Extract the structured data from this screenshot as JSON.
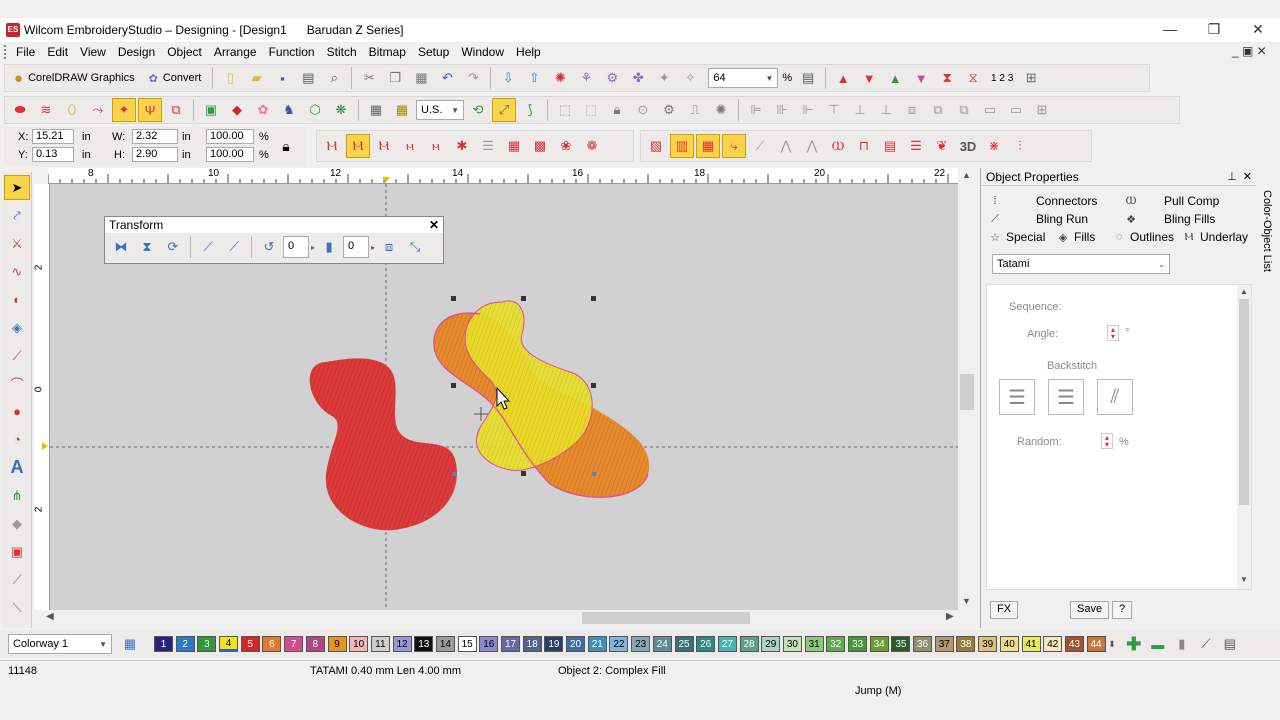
{
  "window": {
    "title": "Wilcom EmbroideryStudio – Designing - [Design1",
    "machine": "Barudan Z Series]",
    "minimize": "—",
    "restore": "❐",
    "close": "✕",
    "mdi_controls": "_ ▣ ✕"
  },
  "menu": [
    "File",
    "Edit",
    "View",
    "Design",
    "Object",
    "Arrange",
    "Function",
    "Stitch",
    "Bitmap",
    "Setup",
    "Window",
    "Help"
  ],
  "toolbar": {
    "coreldraw_label": "CorelDRAW Graphics",
    "convert_label": "Convert",
    "zoom_value": "64",
    "zoom_unit": "%",
    "units_value": "U.S.",
    "sequence_label": "1 2 3"
  },
  "coords": {
    "x_label": "X:",
    "x_value": "15.21",
    "x_unit": "in",
    "y_label": "Y:",
    "y_value": "0.13",
    "y_unit": "in",
    "w_label": "W:",
    "w_value": "2.32",
    "w_unit": "in",
    "h_label": "H:",
    "h_value": "2.90",
    "h_unit": "in",
    "sx_value": "100.00",
    "sx_unit": "%",
    "sy_value": "100.00",
    "sy_unit": "%"
  },
  "stitch_tb": {
    "three_d_label": "3D"
  },
  "ruler": {
    "h_labels": [
      "8",
      "10",
      "12",
      "14",
      "16",
      "18",
      "20",
      "22"
    ],
    "v_labels": [
      "2",
      "0",
      "2"
    ]
  },
  "transform": {
    "title": "Transform",
    "close": "✕",
    "rotate_value": "0",
    "slant_value": "0"
  },
  "object_properties": {
    "title": "Object Properties",
    "pin": "⊥",
    "close": "✕",
    "tabs_row1": [
      "Connectors",
      "Pull Comp"
    ],
    "tabs_row2": [
      "Bling Run",
      "Bling Fills"
    ],
    "tabs_row3": [
      "Special",
      "Fills",
      "Outlines",
      "Underlay"
    ],
    "fill_type": "Tatami",
    "sequence_label": "Sequence:",
    "angle_label": "Angle:",
    "angle_unit": "°",
    "backstitch_label": "Backstitch",
    "random_label": "Random:",
    "random_unit": "%",
    "fx_label": "FX",
    "save_label": "Save",
    "help_label": "?"
  },
  "side_tab_label": "Color-Object List",
  "colorway": {
    "value": "Colorway 1"
  },
  "palette": [
    {
      "n": "1",
      "c": "#23237a",
      "t": "#fff"
    },
    {
      "n": "2",
      "c": "#2f76c9",
      "t": "#fff"
    },
    {
      "n": "3",
      "c": "#2e9a3c",
      "t": "#fff"
    },
    {
      "n": "4",
      "c": "#f4e21b",
      "t": "#000"
    },
    {
      "n": "5",
      "c": "#d42626",
      "t": "#fff"
    },
    {
      "n": "6",
      "c": "#e07a2b",
      "t": "#fff"
    },
    {
      "n": "7",
      "c": "#d04c8c",
      "t": "#fff"
    },
    {
      "n": "8",
      "c": "#b04682",
      "t": "#fff"
    },
    {
      "n": "9",
      "c": "#e8951b",
      "t": "#000"
    },
    {
      "n": "10",
      "c": "#f2b8b8",
      "t": "#000"
    },
    {
      "n": "11",
      "c": "#cfcfcf",
      "t": "#000"
    },
    {
      "n": "12",
      "c": "#9a98d6",
      "t": "#000"
    },
    {
      "n": "13",
      "c": "#111111",
      "t": "#fff"
    },
    {
      "n": "14",
      "c": "#9b9b9b",
      "t": "#000"
    },
    {
      "n": "15",
      "c": "#ffffff",
      "t": "#000"
    },
    {
      "n": "16",
      "c": "#8b88c9",
      "t": "#000"
    },
    {
      "n": "17",
      "c": "#6767a8",
      "t": "#fff"
    },
    {
      "n": "18",
      "c": "#53628a",
      "t": "#fff"
    },
    {
      "n": "19",
      "c": "#2a3e5d",
      "t": "#fff"
    },
    {
      "n": "20",
      "c": "#3b6fa0",
      "t": "#fff"
    },
    {
      "n": "21",
      "c": "#3d8fc4",
      "t": "#fff"
    },
    {
      "n": "22",
      "c": "#7fb6df",
      "t": "#000"
    },
    {
      "n": "23",
      "c": "#86a9b8",
      "t": "#000"
    },
    {
      "n": "24",
      "c": "#5d8a99",
      "t": "#fff"
    },
    {
      "n": "25",
      "c": "#3a6f74",
      "t": "#fff"
    },
    {
      "n": "26",
      "c": "#2d8a81",
      "t": "#fff"
    },
    {
      "n": "27",
      "c": "#4ab3ad",
      "t": "#fff"
    },
    {
      "n": "28",
      "c": "#5a9e8c",
      "t": "#fff"
    },
    {
      "n": "29",
      "c": "#a8d6c8",
      "t": "#000"
    },
    {
      "n": "30",
      "c": "#c7e3b6",
      "t": "#000"
    },
    {
      "n": "31",
      "c": "#8fc97a",
      "t": "#000"
    },
    {
      "n": "32",
      "c": "#5fa84c",
      "t": "#fff"
    },
    {
      "n": "33",
      "c": "#3f9a3a",
      "t": "#fff"
    },
    {
      "n": "34",
      "c": "#6b9c2e",
      "t": "#fff"
    },
    {
      "n": "35",
      "c": "#2a5a2a",
      "t": "#fff"
    },
    {
      "n": "36",
      "c": "#8f8f6a",
      "t": "#fff"
    },
    {
      "n": "37",
      "c": "#b09a6c",
      "t": "#000"
    },
    {
      "n": "38",
      "c": "#9a7a3a",
      "t": "#fff"
    },
    {
      "n": "39",
      "c": "#d8c27a",
      "t": "#000"
    },
    {
      "n": "40",
      "c": "#efe18a",
      "t": "#000"
    },
    {
      "n": "41",
      "c": "#e8ec5a",
      "t": "#000"
    },
    {
      "n": "42",
      "c": "#f2e7c0",
      "t": "#000"
    },
    {
      "n": "43",
      "c": "#a0522d",
      "t": "#fff"
    },
    {
      "n": "44",
      "c": "#c47a3c",
      "t": "#fff"
    }
  ],
  "status": {
    "stitch_count": "11148",
    "stitch_info": "TATAMI  0.40 mm Len  4.00 mm",
    "object_info": "Object 2: Complex Fill",
    "mode": "Jump (M)"
  }
}
